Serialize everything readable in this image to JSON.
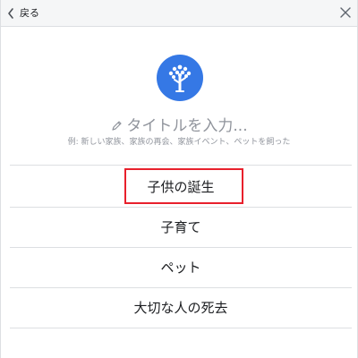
{
  "header": {
    "back_label": "戻る",
    "back_icon": "chevron-left-icon",
    "close_icon": "close-icon"
  },
  "logo": {
    "icon": "tree-icon",
    "color": "#3578e5"
  },
  "title_input": {
    "icon": "pencil-icon",
    "placeholder": "タイトルを入力..."
  },
  "example_text": "例: 新しい家族、家族の再会、家族イベント、ペットを飼った",
  "options": [
    {
      "label": "子供の誕生",
      "highlighted": true
    },
    {
      "label": "子育て",
      "highlighted": false
    },
    {
      "label": "ペット",
      "highlighted": false
    },
    {
      "label": "大切な人の死去",
      "highlighted": false
    }
  ],
  "colors": {
    "header_bg": "#f5f6f7",
    "accent": "#3578e5",
    "highlight_border": "#e8202c",
    "placeholder_text": "#90949c",
    "divider": "#dddfe2"
  }
}
